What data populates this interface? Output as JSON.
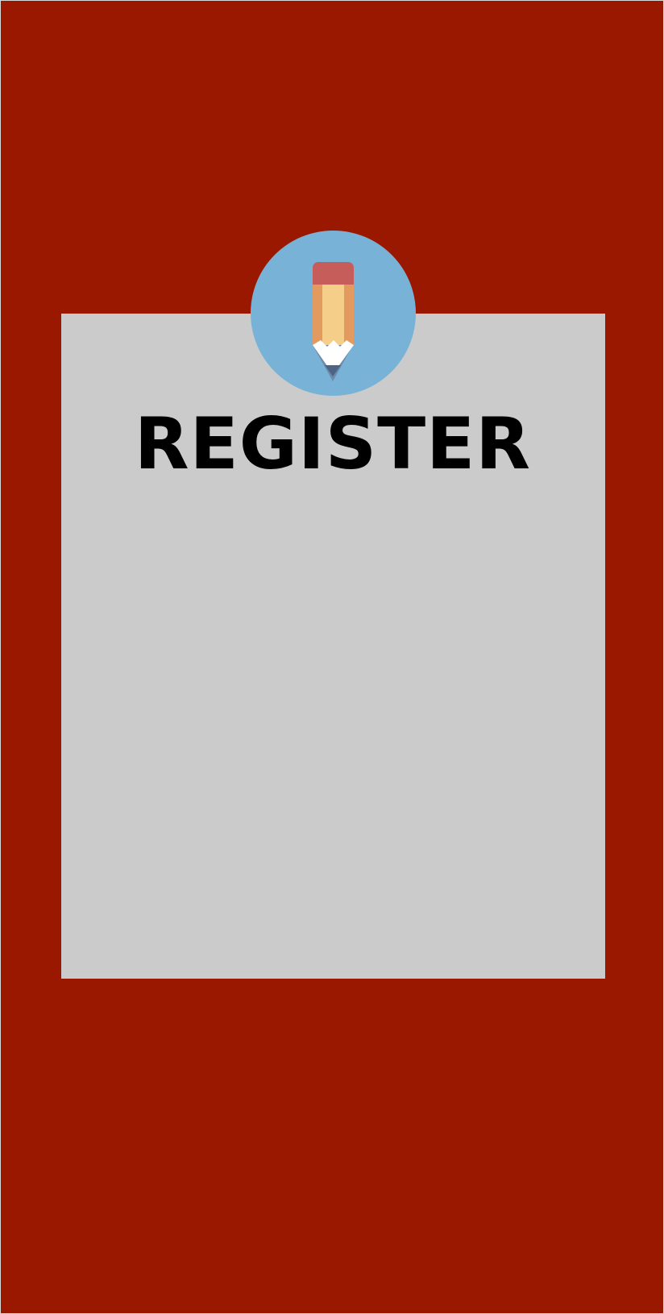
{
  "screen": {
    "background_color": "#9b1800",
    "card_color": "#cbcbcb"
  },
  "badge": {
    "icon": "pencil-icon",
    "background_color": "#78b2d7"
  },
  "title": {
    "text": "REGISTER"
  }
}
